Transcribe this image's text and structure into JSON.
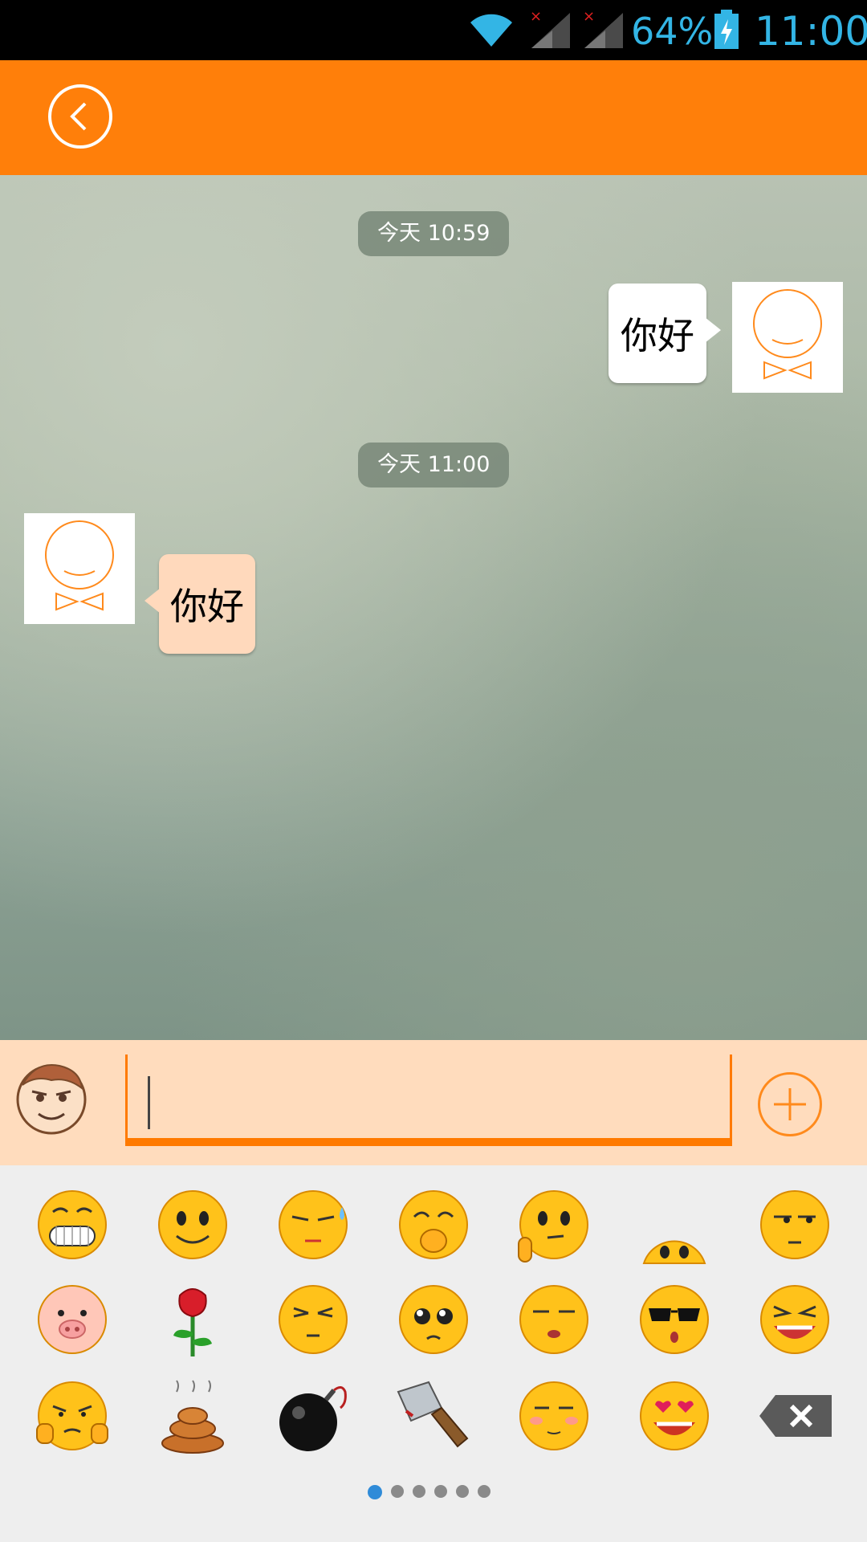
{
  "status_bar": {
    "battery_pct": "64%",
    "time": "11:00",
    "icons": [
      "wifi-icon",
      "signal-icon",
      "signal-icon",
      "battery-charging-icon"
    ]
  },
  "header": {
    "title": "",
    "back_icon": "back-arrow-icon"
  },
  "chat": {
    "messages": [
      {
        "timestamp": "今天 10:59",
        "direction": "outgoing",
        "text": "你好"
      },
      {
        "timestamp": "今天 11:00",
        "direction": "incoming",
        "sender": "",
        "text": "你好"
      }
    ]
  },
  "composer": {
    "emoji_toggle_icon": "cartoon-face-icon",
    "input_value": "",
    "plus_icon": "plus-icon"
  },
  "emoji_panel": {
    "rows": [
      [
        "grin-emoji",
        "smile-emoji",
        "sweat-emoji",
        "giggle-emoji",
        "thinking-emoji",
        "peek-emoji",
        "smirk-emoji"
      ],
      [
        "pig-emoji",
        "rose-emoji",
        "annoyed-emoji",
        "pitiful-emoji",
        "sleepy-emoji",
        "cool-emoji",
        "laugh-emoji"
      ],
      [
        "embarrassed-emoji",
        "poop-emoji",
        "bomb-emoji",
        "cleaver-emoji",
        "blush-emoji",
        "heart-eyes-emoji",
        "delete-key-icon"
      ]
    ],
    "pages": 6,
    "active_page": 1
  },
  "colors": {
    "accent": "#ff7f0a",
    "input_bar": "#ffdcbd",
    "status_blue": "#33b5e5",
    "pager_active": "#2f8bd8"
  }
}
